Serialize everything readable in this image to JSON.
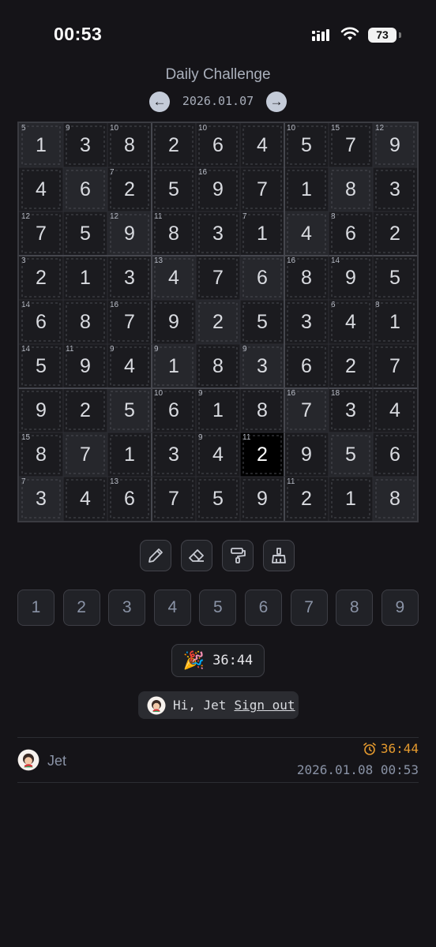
{
  "status_bar": {
    "time": "00:53",
    "battery": "73"
  },
  "header": {
    "title": "Daily Challenge",
    "date": "2026.01.07"
  },
  "board": {
    "rows": [
      [
        "1",
        "3",
        "8",
        "2",
        "6",
        "4",
        "5",
        "7",
        "9"
      ],
      [
        "4",
        "6",
        "2",
        "5",
        "9",
        "7",
        "1",
        "8",
        "3"
      ],
      [
        "7",
        "5",
        "9",
        "8",
        "3",
        "1",
        "4",
        "6",
        "2"
      ],
      [
        "2",
        "1",
        "3",
        "4",
        "7",
        "6",
        "8",
        "9",
        "5"
      ],
      [
        "6",
        "8",
        "7",
        "9",
        "2",
        "5",
        "3",
        "4",
        "1"
      ],
      [
        "5",
        "9",
        "4",
        "1",
        "8",
        "3",
        "6",
        "2",
        "7"
      ],
      [
        "9",
        "2",
        "5",
        "6",
        "1",
        "8",
        "7",
        "3",
        "4"
      ],
      [
        "8",
        "7",
        "1",
        "3",
        "4",
        "2",
        "9",
        "5",
        "6"
      ],
      [
        "3",
        "4",
        "6",
        "7",
        "5",
        "9",
        "2",
        "1",
        "8"
      ]
    ],
    "cage_clues": [
      {
        "row": 0,
        "col": 0,
        "sum": "5"
      },
      {
        "row": 0,
        "col": 1,
        "sum": "9"
      },
      {
        "row": 0,
        "col": 2,
        "sum": "10"
      },
      {
        "row": 0,
        "col": 4,
        "sum": "10"
      },
      {
        "row": 0,
        "col": 6,
        "sum": "10"
      },
      {
        "row": 0,
        "col": 7,
        "sum": "15"
      },
      {
        "row": 0,
        "col": 8,
        "sum": "12"
      },
      {
        "row": 1,
        "col": 2,
        "sum": "7"
      },
      {
        "row": 1,
        "col": 4,
        "sum": "16"
      },
      {
        "row": 2,
        "col": 0,
        "sum": "12"
      },
      {
        "row": 2,
        "col": 2,
        "sum": "12"
      },
      {
        "row": 2,
        "col": 3,
        "sum": "11"
      },
      {
        "row": 2,
        "col": 5,
        "sum": "7"
      },
      {
        "row": 2,
        "col": 7,
        "sum": "8"
      },
      {
        "row": 3,
        "col": 0,
        "sum": "3"
      },
      {
        "row": 3,
        "col": 3,
        "sum": "13"
      },
      {
        "row": 3,
        "col": 6,
        "sum": "16"
      },
      {
        "row": 3,
        "col": 7,
        "sum": "14"
      },
      {
        "row": 4,
        "col": 0,
        "sum": "14"
      },
      {
        "row": 4,
        "col": 2,
        "sum": "16"
      },
      {
        "row": 4,
        "col": 7,
        "sum": "6"
      },
      {
        "row": 4,
        "col": 8,
        "sum": "8"
      },
      {
        "row": 5,
        "col": 0,
        "sum": "14"
      },
      {
        "row": 5,
        "col": 1,
        "sum": "11"
      },
      {
        "row": 5,
        "col": 2,
        "sum": "9"
      },
      {
        "row": 5,
        "col": 3,
        "sum": "9"
      },
      {
        "row": 5,
        "col": 5,
        "sum": "9"
      },
      {
        "row": 6,
        "col": 3,
        "sum": "10"
      },
      {
        "row": 6,
        "col": 4,
        "sum": "9"
      },
      {
        "row": 6,
        "col": 6,
        "sum": "16"
      },
      {
        "row": 6,
        "col": 7,
        "sum": "18"
      },
      {
        "row": 7,
        "col": 0,
        "sum": "15"
      },
      {
        "row": 7,
        "col": 4,
        "sum": "9"
      },
      {
        "row": 7,
        "col": 5,
        "sum": "11"
      },
      {
        "row": 8,
        "col": 0,
        "sum": "7"
      },
      {
        "row": 8,
        "col": 2,
        "sum": "13"
      },
      {
        "row": 8,
        "col": 6,
        "sum": "11"
      }
    ],
    "shaded_cells": [
      [
        0,
        0
      ],
      [
        0,
        8
      ],
      [
        1,
        1
      ],
      [
        1,
        7
      ],
      [
        2,
        2
      ],
      [
        2,
        6
      ],
      [
        3,
        3
      ],
      [
        3,
        5
      ],
      [
        4,
        4
      ],
      [
        5,
        3
      ],
      [
        5,
        5
      ],
      [
        6,
        2
      ],
      [
        6,
        6
      ],
      [
        7,
        1
      ],
      [
        7,
        7
      ],
      [
        8,
        0
      ],
      [
        8,
        8
      ]
    ],
    "selected_cell": [
      7,
      5
    ]
  },
  "tools": [
    {
      "name": "pencil-tool",
      "icon": "pencil-icon"
    },
    {
      "name": "eraser-tool",
      "icon": "eraser-icon"
    },
    {
      "name": "paint-roller-tool",
      "icon": "paint-roller-icon"
    },
    {
      "name": "broom-tool",
      "icon": "broom-icon"
    }
  ],
  "numpad": [
    "1",
    "2",
    "3",
    "4",
    "5",
    "6",
    "7",
    "8",
    "9"
  ],
  "timer": {
    "icon": "party-popper-icon",
    "value": "36:44"
  },
  "user": {
    "greeting": "Hi, Jet",
    "signout": "Sign out"
  },
  "record": {
    "name": "Jet",
    "time": "36:44",
    "date": "2026.01.08 00:53",
    "time_color": "#e59a2e"
  }
}
